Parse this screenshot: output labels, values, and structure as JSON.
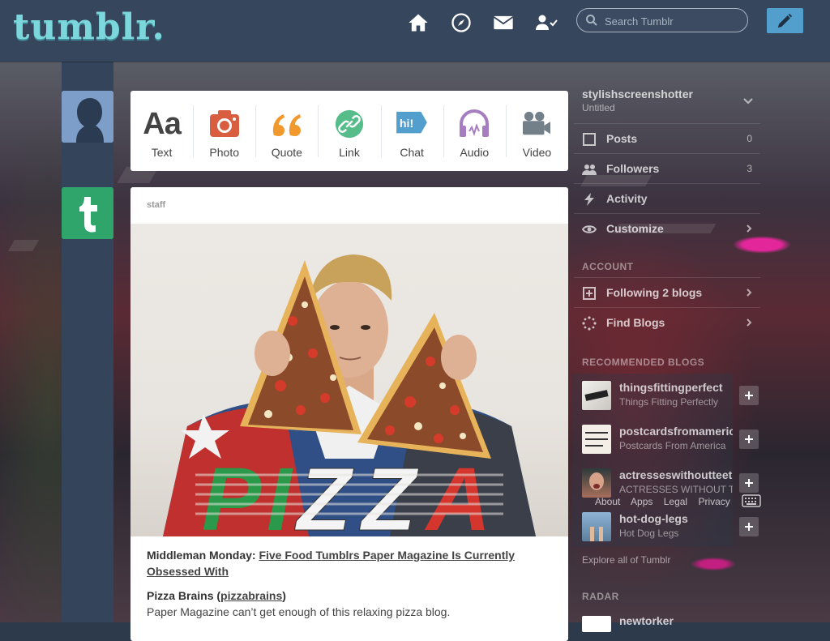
{
  "header": {
    "logo_text": "tumblr.",
    "search": {
      "placeholder": "Search Tumblr",
      "value": ""
    },
    "nav": [
      "home-icon",
      "explore-icon",
      "inbox-icon",
      "account-icon"
    ],
    "compose_icon": "pencil-icon",
    "accent_color": "#529ecc"
  },
  "post_types": [
    {
      "label": "Text",
      "icon": "text-icon",
      "color": "#444444"
    },
    {
      "label": "Photo",
      "icon": "camera-icon",
      "color": "#d95e40"
    },
    {
      "label": "Quote",
      "icon": "quote-icon",
      "color": "#f2992e"
    },
    {
      "label": "Link",
      "icon": "link-icon",
      "color": "#56bc8a"
    },
    {
      "label": "Chat",
      "icon": "chat-icon",
      "color": "#529ecc"
    },
    {
      "label": "Audio",
      "icon": "headphones-icon",
      "color": "#a77dc2"
    },
    {
      "label": "Video",
      "icon": "video-camera-icon",
      "color": "#748089"
    }
  ],
  "post": {
    "author": "staff",
    "image_text": "PIZZA",
    "title_prefix": "Middleman Monday:",
    "title_link": "Five Food Tumblrs Paper Magazine Is Currently Obsessed With",
    "item_name": "Pizza Brains (",
    "item_link": "pizzabrains",
    "item_suffix": ")",
    "item_desc": "Paper Magazine can’t get enough of this relaxing pizza blog."
  },
  "sidebar": {
    "blog_name": "stylishscreenshotter",
    "blog_subtitle": "Untitled",
    "rows": [
      {
        "label": "Posts",
        "count": "0",
        "icon": "posts-icon"
      },
      {
        "label": "Followers",
        "count": "3",
        "icon": "followers-icon"
      },
      {
        "label": "Activity",
        "count": "",
        "icon": "activity-icon"
      },
      {
        "label": "Customize",
        "count": "",
        "icon": "eye-icon"
      }
    ],
    "account_title": "ACCOUNT",
    "account_rows": [
      {
        "label": "Following 2 blogs",
        "icon": "following-icon"
      },
      {
        "label": "Find Blogs",
        "icon": "find-blogs-icon"
      }
    ],
    "recommended_title": "RECOMMENDED BLOGS",
    "recommended": [
      {
        "name": "thingsfittingperfect",
        "desc": "Things Fitting Perfectly"
      },
      {
        "name": "postcardsfromamerica",
        "desc": "Postcards From America"
      },
      {
        "name": "actresseswithoutteeth",
        "desc": "ACTRESSES WITHOUT TEETH"
      },
      {
        "name": "hot-dog-legs",
        "desc": "Hot Dog Legs"
      }
    ],
    "footer_links": [
      "About",
      "Apps",
      "Legal",
      "Privacy"
    ],
    "explore_label": "Explore all of Tumblr",
    "radar_title": "RADAR",
    "radar_item": "newtorker"
  }
}
